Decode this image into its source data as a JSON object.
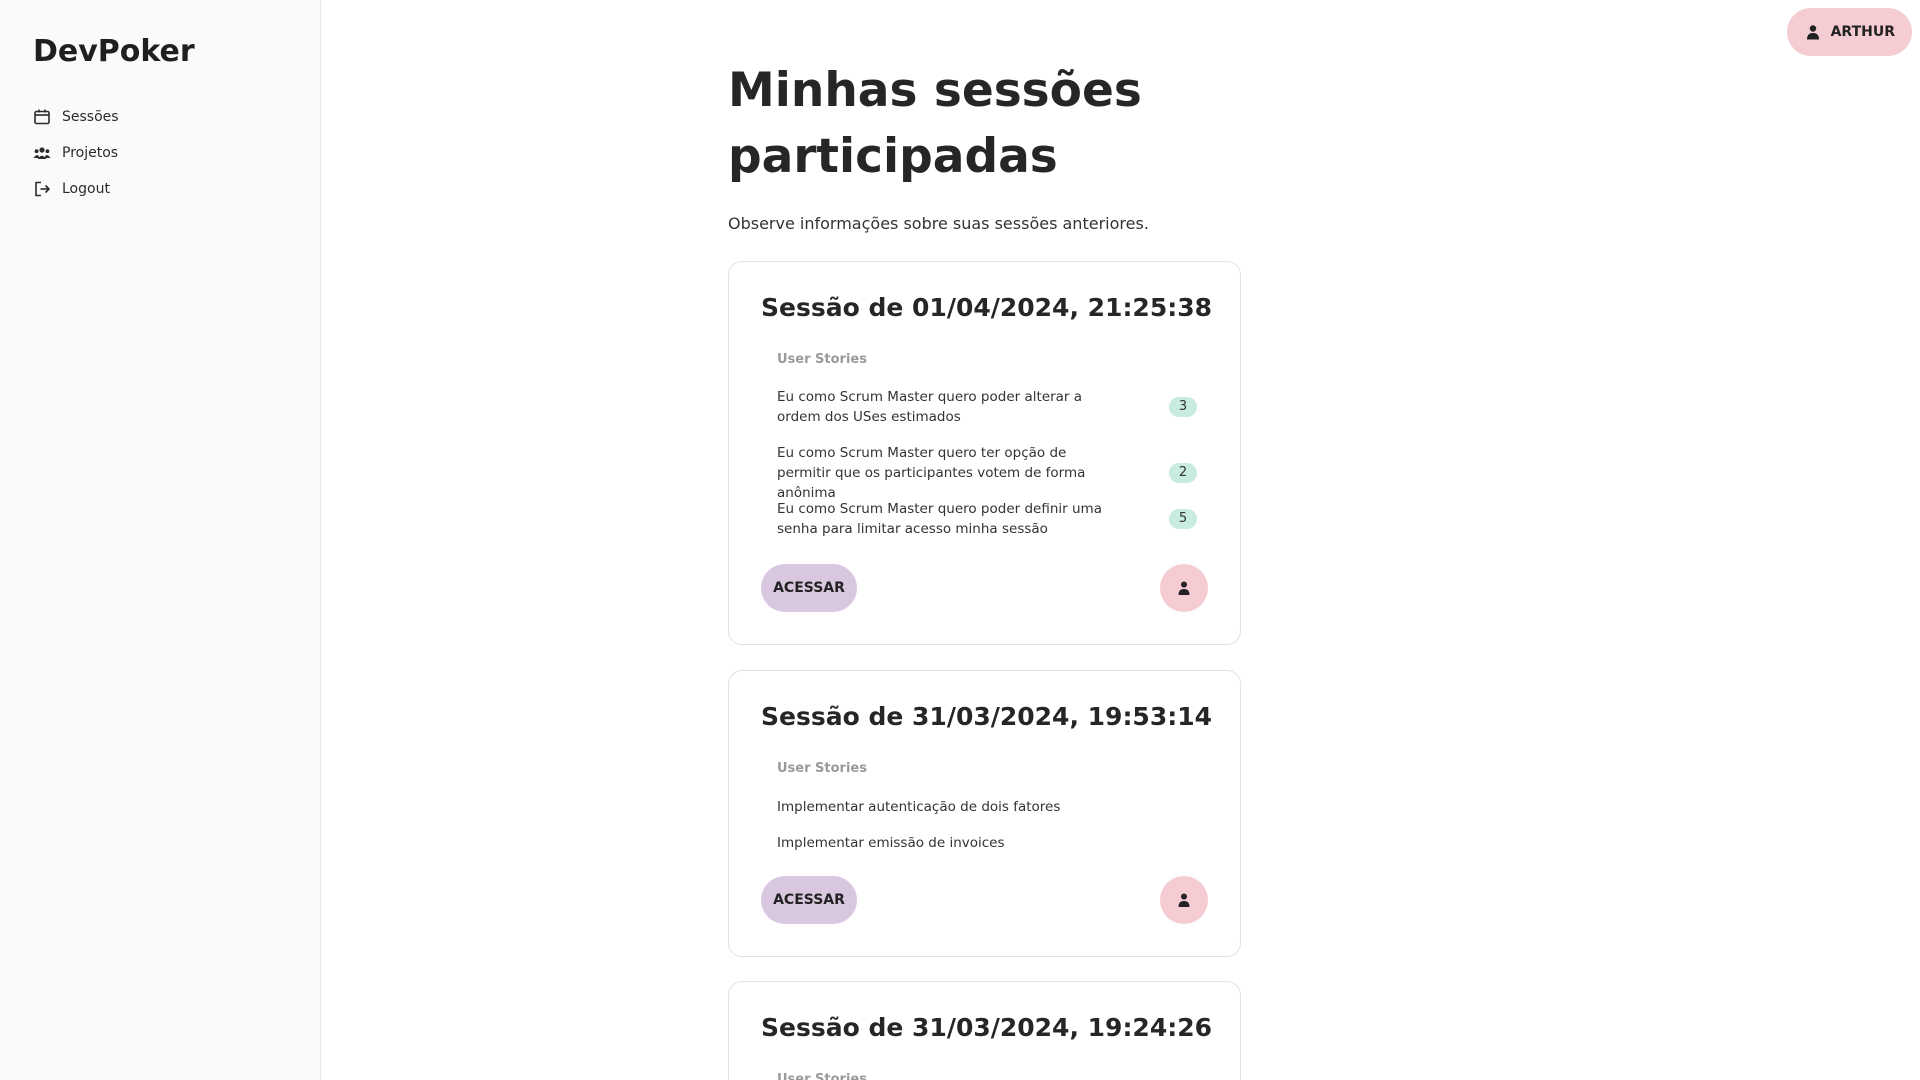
{
  "sidebar": {
    "brand": "DevPoker",
    "items": [
      {
        "label": "Sessões",
        "icon": "calendar-icon"
      },
      {
        "label": "Projetos",
        "icon": "users-icon"
      },
      {
        "label": "Logout",
        "icon": "logout-icon"
      }
    ]
  },
  "header": {
    "user_name": "ARTHUR",
    "user_icon": "user-icon"
  },
  "main": {
    "title": "Minhas sessões participadas",
    "subtitle": "Observe informações sobre suas sessões anteriores.",
    "stories_label": "User Stories",
    "access_label": "ACESSAR",
    "sessions": [
      {
        "title": "Sessão de 01/04/2024, 21:25:38",
        "stories": [
          {
            "text": "Eu como Scrum Master quero poder alterar a ordem dos USes estimados",
            "estimate": "3"
          },
          {
            "text": "Eu como Scrum Master quero ter opção de permitir que os participantes votem de forma anônima",
            "estimate": "2"
          },
          {
            "text": "Eu como Scrum Master quero poder definir uma senha para limitar acesso minha sessão",
            "estimate": "5"
          }
        ]
      },
      {
        "title": "Sessão de 31/03/2024, 19:53:14",
        "stories": [
          {
            "text": "Implementar autenticação de dois fatores"
          },
          {
            "text": "Implementar emissão de invoices"
          }
        ]
      },
      {
        "title": "Sessão de 31/03/2024, 19:24:26",
        "stories": []
      }
    ]
  },
  "colors": {
    "sidebar_bg": "#f9fafb",
    "user_chip_bg": "#f6ccd3",
    "access_button_bg": "#d9c6df",
    "estimate_badge_bg": "#c8ecdd"
  }
}
